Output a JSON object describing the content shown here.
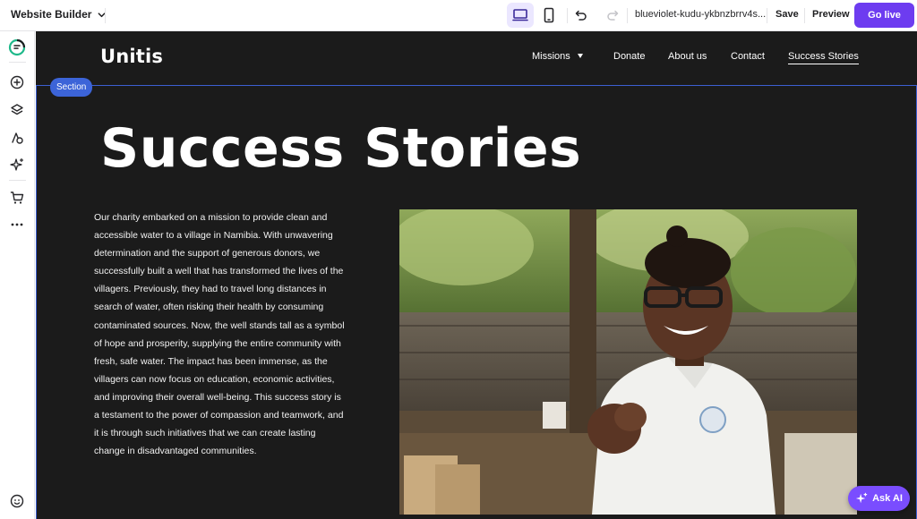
{
  "topbar": {
    "app_title": "Website Builder",
    "url": "blueviolet-kudu-ykbnzbrrv4s...",
    "save_label": "Save",
    "preview_label": "Preview",
    "go_live_label": "Go live",
    "icons": [
      "chevron-down-icon",
      "desktop-icon",
      "mobile-icon",
      "undo-icon",
      "redo-icon"
    ]
  },
  "rail": {
    "icons": [
      "logo-icon",
      "add-icon",
      "layers-icon",
      "theme-icon",
      "ai-sparkle-icon",
      "cart-icon",
      "more-icon",
      "help-icon"
    ]
  },
  "site": {
    "logo": "Unitis",
    "nav": [
      {
        "label": "Missions"
      },
      {
        "label": "Donate"
      },
      {
        "label": "About us"
      },
      {
        "label": "Contact"
      },
      {
        "label": "Success Stories"
      }
    ],
    "section_badge": "Section",
    "hero_title": "Success Stories",
    "story_text": "Our charity embarked on a mission to provide clean and accessible water to a village in Namibia. With unwavering determination and the support of generous donors, we successfully built a well that has transformed the lives of the villagers. Previously, they had to travel long distances in search of water, often risking their health by consuming contaminated sources. Now, the well stands tall as a symbol of hope and prosperity, supplying the entire community with fresh, safe water. The impact has been immense, as the villagers can now focus on education, economic activities, and improving their overall well-being. This success story is a testament to the power of compassion and teamwork, and it is through such initiatives that we can create lasting change in disadvantaged communities."
  },
  "ask_ai_label": "Ask AI",
  "colors": {
    "accent": "#6d3cf0",
    "selection": "#3c64d8",
    "canvas_bg": "#1b1b1b"
  }
}
